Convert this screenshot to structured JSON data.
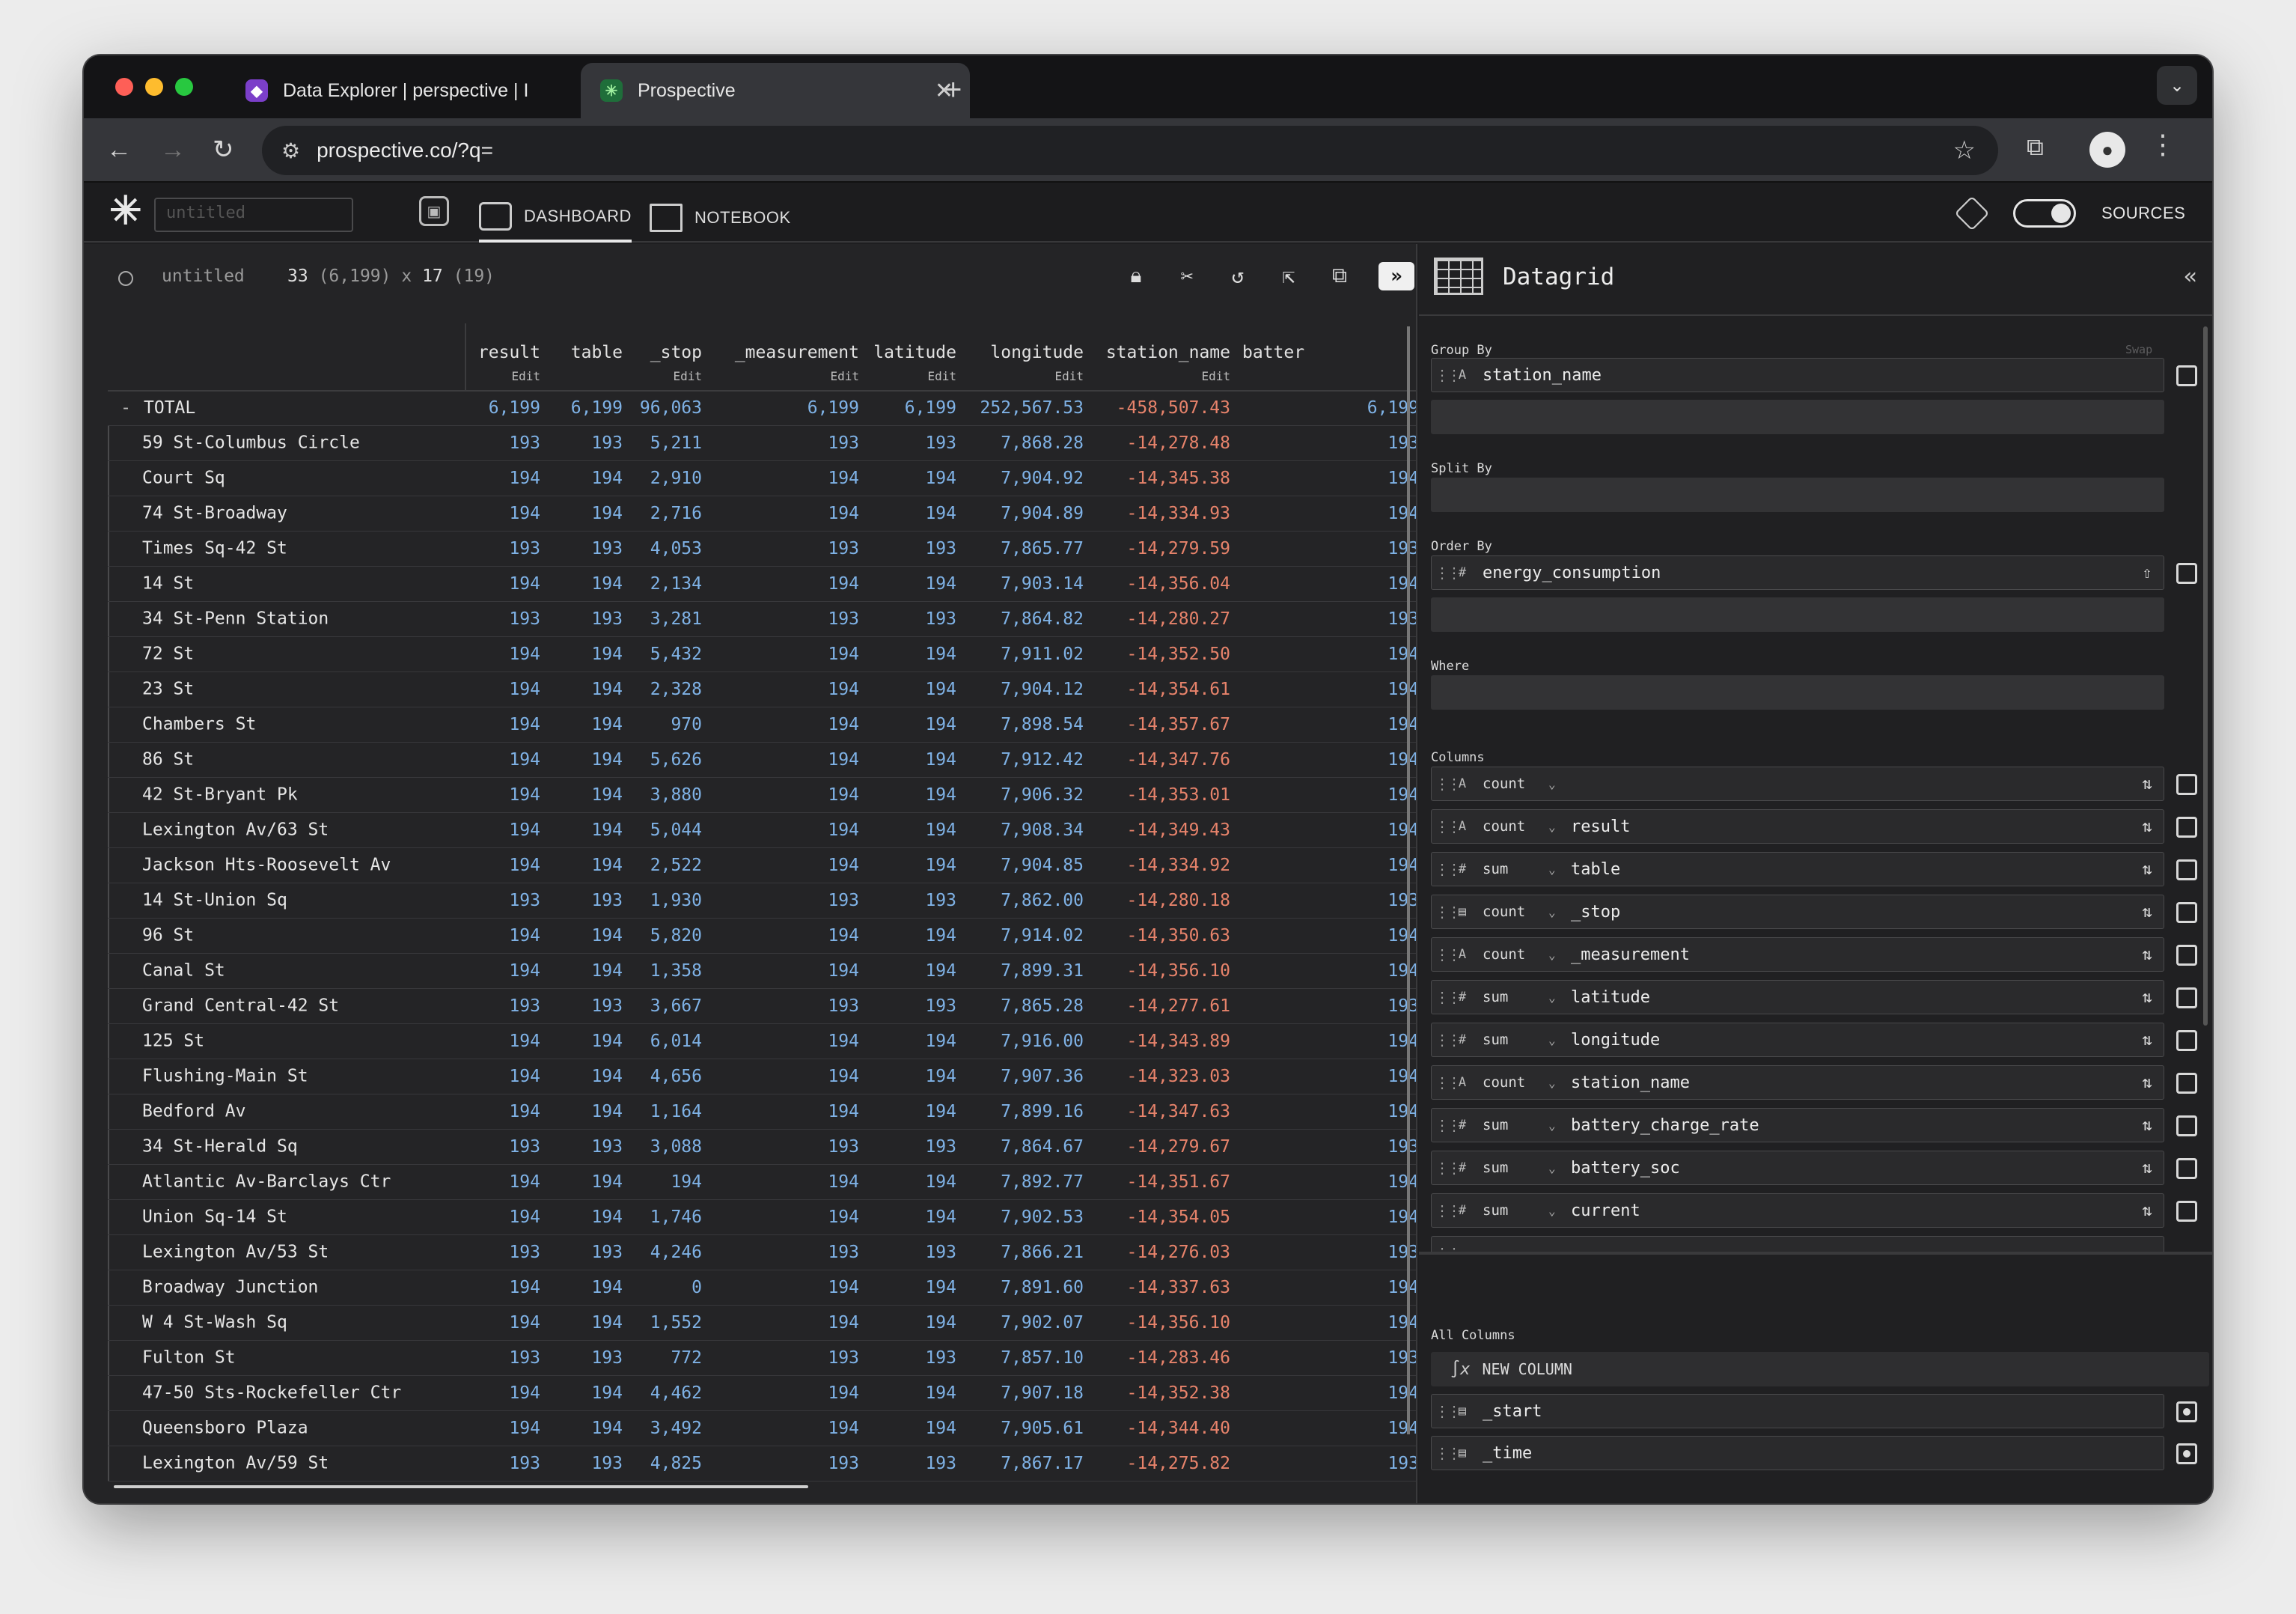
{
  "browser": {
    "tabs": [
      {
        "title": "Data Explorer | perspective | I",
        "active": false
      },
      {
        "title": "Prospective",
        "active": true
      }
    ],
    "url": "prospective.co/?q="
  },
  "app": {
    "title_placeholder": "untitled",
    "nav": {
      "dashboard": "DASHBOARD",
      "notebook": "NOTEBOOK"
    },
    "sources_label": "SOURCES"
  },
  "grid_status": {
    "name": "untitled",
    "dims": "33 (6,199) x 17 (19)",
    "rows_shown": "33",
    "rows_total": "(6,199)",
    "x": "x",
    "cols_shown": "17",
    "cols_total": "(19)"
  },
  "grid": {
    "columns": [
      "result",
      "table",
      "_stop",
      "_measurement",
      "latitude",
      "longitude",
      "station_name",
      "batter"
    ],
    "edit_label": "Edit",
    "total": {
      "prefix": "-",
      "label": "TOTAL",
      "values": [
        "6,199",
        "6,199",
        "96,063",
        "6,199",
        "6,199",
        "252,567.53",
        "-458,507.43",
        "6,199",
        ""
      ]
    },
    "rows": [
      {
        "label": "59 St-Columbus Circle",
        "values": [
          "193",
          "193",
          "5,211",
          "193",
          "193",
          "7,868.28",
          "-14,278.48",
          "193"
        ]
      },
      {
        "label": "Court Sq",
        "values": [
          "194",
          "194",
          "2,910",
          "194",
          "194",
          "7,904.92",
          "-14,345.38",
          "194"
        ]
      },
      {
        "label": "74 St-Broadway",
        "values": [
          "194",
          "194",
          "2,716",
          "194",
          "194",
          "7,904.89",
          "-14,334.93",
          "194"
        ]
      },
      {
        "label": "Times Sq-42 St",
        "values": [
          "193",
          "193",
          "4,053",
          "193",
          "193",
          "7,865.77",
          "-14,279.59",
          "193"
        ]
      },
      {
        "label": "14 St",
        "values": [
          "194",
          "194",
          "2,134",
          "194",
          "194",
          "7,903.14",
          "-14,356.04",
          "194"
        ]
      },
      {
        "label": "34 St-Penn Station",
        "values": [
          "193",
          "193",
          "3,281",
          "193",
          "193",
          "7,864.82",
          "-14,280.27",
          "193"
        ]
      },
      {
        "label": "72 St",
        "values": [
          "194",
          "194",
          "5,432",
          "194",
          "194",
          "7,911.02",
          "-14,352.50",
          "194"
        ]
      },
      {
        "label": "23 St",
        "values": [
          "194",
          "194",
          "2,328",
          "194",
          "194",
          "7,904.12",
          "-14,354.61",
          "194"
        ]
      },
      {
        "label": "Chambers St",
        "values": [
          "194",
          "194",
          "970",
          "194",
          "194",
          "7,898.54",
          "-14,357.67",
          "194"
        ]
      },
      {
        "label": "86 St",
        "values": [
          "194",
          "194",
          "5,626",
          "194",
          "194",
          "7,912.42",
          "-14,347.76",
          "194"
        ]
      },
      {
        "label": "42 St-Bryant Pk",
        "values": [
          "194",
          "194",
          "3,880",
          "194",
          "194",
          "7,906.32",
          "-14,353.01",
          "194"
        ]
      },
      {
        "label": "Lexington Av/63 St",
        "values": [
          "194",
          "194",
          "5,044",
          "194",
          "194",
          "7,908.34",
          "-14,349.43",
          "194"
        ]
      },
      {
        "label": "Jackson Hts-Roosevelt Av",
        "values": [
          "194",
          "194",
          "2,522",
          "194",
          "194",
          "7,904.85",
          "-14,334.92",
          "194"
        ]
      },
      {
        "label": "14 St-Union Sq",
        "values": [
          "193",
          "193",
          "1,930",
          "193",
          "193",
          "7,862.00",
          "-14,280.18",
          "193"
        ]
      },
      {
        "label": "96 St",
        "values": [
          "194",
          "194",
          "5,820",
          "194",
          "194",
          "7,914.02",
          "-14,350.63",
          "194"
        ]
      },
      {
        "label": "Canal St",
        "values": [
          "194",
          "194",
          "1,358",
          "194",
          "194",
          "7,899.31",
          "-14,356.10",
          "194"
        ]
      },
      {
        "label": "Grand Central-42 St",
        "values": [
          "193",
          "193",
          "3,667",
          "193",
          "193",
          "7,865.28",
          "-14,277.61",
          "193"
        ]
      },
      {
        "label": "125 St",
        "values": [
          "194",
          "194",
          "6,014",
          "194",
          "194",
          "7,916.00",
          "-14,343.89",
          "194"
        ]
      },
      {
        "label": "Flushing-Main St",
        "values": [
          "194",
          "194",
          "4,656",
          "194",
          "194",
          "7,907.36",
          "-14,323.03",
          "194"
        ]
      },
      {
        "label": "Bedford Av",
        "values": [
          "194",
          "194",
          "1,164",
          "194",
          "194",
          "7,899.16",
          "-14,347.63",
          "194"
        ]
      },
      {
        "label": "34 St-Herald Sq",
        "values": [
          "193",
          "193",
          "3,088",
          "193",
          "193",
          "7,864.67",
          "-14,279.67",
          "193"
        ]
      },
      {
        "label": "Atlantic Av-Barclays Ctr",
        "values": [
          "194",
          "194",
          "194",
          "194",
          "194",
          "7,892.77",
          "-14,351.67",
          "194"
        ]
      },
      {
        "label": "Union Sq-14 St",
        "values": [
          "194",
          "194",
          "1,746",
          "194",
          "194",
          "7,902.53",
          "-14,354.05",
          "194"
        ]
      },
      {
        "label": "Lexington Av/53 St",
        "values": [
          "193",
          "193",
          "4,246",
          "193",
          "193",
          "7,866.21",
          "-14,276.03",
          "193"
        ]
      },
      {
        "label": "Broadway Junction",
        "values": [
          "194",
          "194",
          "0",
          "194",
          "194",
          "7,891.60",
          "-14,337.63",
          "194"
        ]
      },
      {
        "label": "W 4 St-Wash Sq",
        "values": [
          "194",
          "194",
          "1,552",
          "194",
          "194",
          "7,902.07",
          "-14,356.10",
          "194"
        ]
      },
      {
        "label": "Fulton St",
        "values": [
          "193",
          "193",
          "772",
          "193",
          "193",
          "7,857.10",
          "-14,283.46",
          "193"
        ]
      },
      {
        "label": "47-50 Sts-Rockefeller Ctr",
        "values": [
          "194",
          "194",
          "4,462",
          "194",
          "194",
          "7,907.18",
          "-14,352.38",
          "194"
        ]
      },
      {
        "label": "Queensboro Plaza",
        "values": [
          "194",
          "194",
          "3,492",
          "194",
          "194",
          "7,905.61",
          "-14,344.40",
          "194"
        ]
      },
      {
        "label": "Lexington Av/59 St",
        "values": [
          "193",
          "193",
          "4,825",
          "193",
          "193",
          "7,867.17",
          "-14,275.82",
          "193"
        ]
      }
    ]
  },
  "panel": {
    "title": "Datagrid",
    "group_by_label": "Group By",
    "swap_label": "Swap",
    "group_by": [
      {
        "type": "string",
        "name": "station_name"
      }
    ],
    "split_by_label": "Split By",
    "order_by_label": "Order By",
    "order_by": [
      {
        "type": "number",
        "name": "energy_consumption",
        "direction": "asc"
      }
    ],
    "where_label": "Where",
    "columns_label": "Columns",
    "columns": [
      {
        "type": "string",
        "agg": "count",
        "name": ""
      },
      {
        "type": "string",
        "agg": "count",
        "name": "result"
      },
      {
        "type": "number",
        "agg": "sum",
        "name": "table"
      },
      {
        "type": "datetime",
        "agg": "count",
        "name": "_stop"
      },
      {
        "type": "string",
        "agg": "count",
        "name": "_measurement"
      },
      {
        "type": "number",
        "agg": "sum",
        "name": "latitude"
      },
      {
        "type": "number",
        "agg": "sum",
        "name": "longitude"
      },
      {
        "type": "string",
        "agg": "count",
        "name": "station_name"
      },
      {
        "type": "number",
        "agg": "sum",
        "name": "battery_charge_rate"
      },
      {
        "type": "number",
        "agg": "sum",
        "name": "battery_soc"
      },
      {
        "type": "number",
        "agg": "sum",
        "name": "current"
      }
    ],
    "all_columns_label": "All Columns",
    "new_column_label": "NEW COLUMN",
    "inactive_columns": [
      {
        "type": "datetime",
        "name": "_start"
      },
      {
        "type": "datetime",
        "name": "_time"
      }
    ]
  },
  "icons": {
    "tab1_favicon": "perspective-logo-icon",
    "tab2_favicon": "prospective-asterisk-icon",
    "type_string": "text-type-icon",
    "type_number": "hash-type-icon",
    "type_datetime": "calendar-type-icon"
  },
  "colors": {
    "positive": "#7fb2e6",
    "negative": "#e7836b",
    "tab2_favicon_bg": "#1f6e3a",
    "tab1_favicon_bg": "#7b3fc9"
  }
}
